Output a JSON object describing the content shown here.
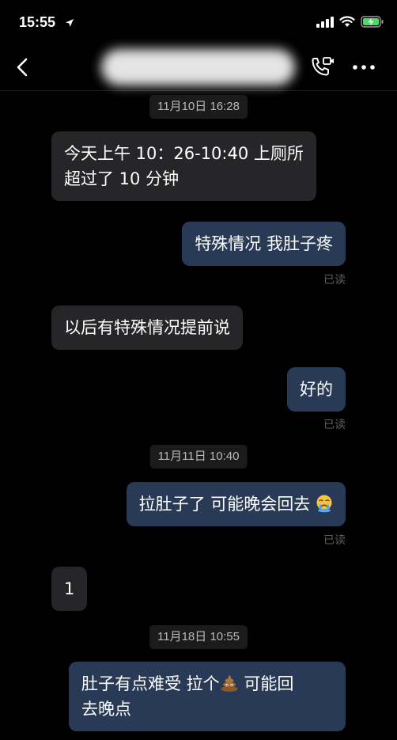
{
  "status_bar": {
    "time": "15:55"
  },
  "chat": {
    "read_label": "已读",
    "messages": [
      {
        "type": "timestamp",
        "text": "11月10日 16:28"
      },
      {
        "type": "incoming",
        "lines": [
          "今天上午 10：26-10:40 上厕所",
          "超过了 10 分钟"
        ]
      },
      {
        "type": "outgoing",
        "text": "特殊情况 我肚子疼"
      },
      {
        "type": "incoming",
        "text": "以后有特殊情况提前说"
      },
      {
        "type": "outgoing",
        "text": "好的"
      },
      {
        "type": "timestamp",
        "text": "11月11日 10:40"
      },
      {
        "type": "outgoing",
        "text": "拉肚子了 可能晚会回去",
        "emoji": "crying-face"
      },
      {
        "type": "incoming",
        "text": "1"
      },
      {
        "type": "timestamp",
        "text": "11月18日 10:55"
      },
      {
        "type": "outgoing",
        "text_before": "肚子有点难受 拉个",
        "emoji": "poop",
        "text_after": " 可能回",
        "line2": "去晚点"
      }
    ]
  }
}
